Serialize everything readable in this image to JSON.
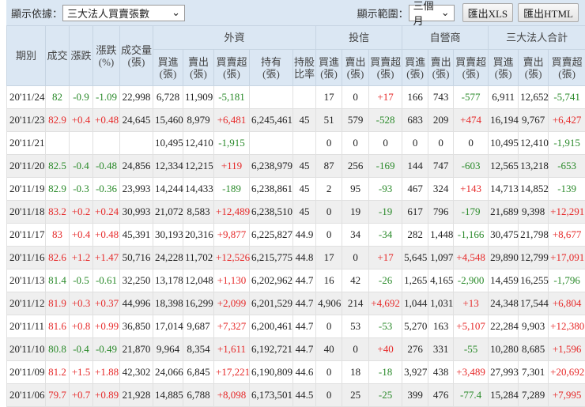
{
  "toolbar": {
    "basis_label": "顯示依據：",
    "basis_value": "三大法人買賣張數",
    "range_label": "顯示範圍：",
    "range_value": "三個月",
    "export_xls": "匯出XLS",
    "export_html": "匯出HTML"
  },
  "headers": {
    "period": "期別",
    "close": "成交",
    "change": "漲跌",
    "change_pct": "漲跌\n(%)",
    "volume": "成交量\n(張)",
    "groups": [
      "外資",
      "投信",
      "自營商",
      "三大法人合計"
    ],
    "sub": [
      "買進\n(張)",
      "賣出\n(張)",
      "買賣超\n(張)",
      "持有\n(張)",
      "持股\n比率",
      "買進\n(張)",
      "賣出\n(張)",
      "買賣超\n(張)",
      "買進\n(張)",
      "賣出\n(張)",
      "買賣超\n(張)",
      "買進\n(張)",
      "賣出\n(張)",
      "買賣超\n(張)"
    ]
  },
  "colors": {
    "up": "#e62a2a",
    "down": "#2a8a2a",
    "header_bg": "#dbe7f3"
  },
  "rows": [
    [
      "20'11/24",
      "82",
      "-0.9",
      "-1.09",
      "22,998",
      "6,728",
      "11,909",
      "-5,181",
      "",
      "",
      "17",
      "0",
      "+17",
      "166",
      "743",
      "-577",
      "6,911",
      "12,652",
      "-5,741"
    ],
    [
      "20'11/23",
      "82.9",
      "+0.4",
      "+0.48",
      "24,645",
      "15,460",
      "8,979",
      "+6,481",
      "6,245,461",
      "45",
      "51",
      "579",
      "-528",
      "683",
      "209",
      "+474",
      "16,194",
      "9,767",
      "+6,427"
    ],
    [
      "20'11/21",
      "",
      "",
      "",
      "",
      "10,495",
      "12,410",
      "-1,915",
      "",
      "",
      "0",
      "0",
      "0",
      "0",
      "0",
      "0",
      "10,495",
      "12,410",
      "-1,915"
    ],
    [
      "20'11/20",
      "82.5",
      "-0.4",
      "-0.48",
      "24,856",
      "12,334",
      "12,215",
      "+119",
      "6,238,979",
      "45",
      "87",
      "256",
      "-169",
      "144",
      "747",
      "-603",
      "12,565",
      "13,218",
      "-653"
    ],
    [
      "20'11/19",
      "82.9",
      "-0.3",
      "-0.36",
      "23,993",
      "14,244",
      "14,433",
      "-189",
      "6,238,861",
      "45",
      "2",
      "95",
      "-93",
      "467",
      "324",
      "+143",
      "14,713",
      "14,852",
      "-139"
    ],
    [
      "20'11/18",
      "83.2",
      "+0.2",
      "+0.24",
      "30,993",
      "21,072",
      "8,583",
      "+12,489",
      "6,238,510",
      "45",
      "0",
      "19",
      "-19",
      "617",
      "796",
      "-179",
      "21,689",
      "9,398",
      "+12,291"
    ],
    [
      "20'11/17",
      "83",
      "+0.4",
      "+0.48",
      "45,391",
      "30,193",
      "20,316",
      "+9,877",
      "6,225,827",
      "44.9",
      "0",
      "34",
      "-34",
      "282",
      "1,448",
      "-1,166",
      "30,475",
      "21,798",
      "+8,677"
    ],
    [
      "20'11/16",
      "82.6",
      "+1.2",
      "+1.47",
      "50,716",
      "24,228",
      "11,702",
      "+12,526",
      "6,215,775",
      "44.8",
      "17",
      "0",
      "+17",
      "5,645",
      "1,097",
      "+4,548",
      "29,890",
      "12,799",
      "+17,091"
    ],
    [
      "20'11/13",
      "81.4",
      "-0.5",
      "-0.61",
      "32,250",
      "13,178",
      "12,048",
      "+1,130",
      "6,202,962",
      "44.7",
      "16",
      "42",
      "-26",
      "1,265",
      "4,165",
      "-2,900",
      "14,459",
      "16,255",
      "-1,796"
    ],
    [
      "20'11/12",
      "81.9",
      "+0.3",
      "+0.37",
      "44,996",
      "18,398",
      "16,299",
      "+2,099",
      "6,201,529",
      "44.7",
      "4,906",
      "214",
      "+4,692",
      "1,044",
      "1,031",
      "+13",
      "24,348",
      "17,544",
      "+6,804"
    ],
    [
      "20'11/11",
      "81.6",
      "+0.8",
      "+0.99",
      "36,850",
      "17,014",
      "9,687",
      "+7,327",
      "6,200,461",
      "44.7",
      "0",
      "53",
      "-53",
      "5,270",
      "163",
      "+5,107",
      "22,284",
      "9,903",
      "+12,380"
    ],
    [
      "20'11/10",
      "80.8",
      "-0.4",
      "-0.49",
      "21,870",
      "9,964",
      "8,354",
      "+1,611",
      "6,192,721",
      "44.7",
      "40",
      "0",
      "+40",
      "276",
      "331",
      "-55",
      "10,280",
      "8,685",
      "+1,596"
    ],
    [
      "20'11/09",
      "81.2",
      "+1.5",
      "+1.88",
      "42,302",
      "24,066",
      "6,845",
      "+17,221",
      "6,190,809",
      "44.6",
      "0",
      "18",
      "-18",
      "3,927",
      "438",
      "+3,489",
      "27,993",
      "7,301",
      "+20,692"
    ],
    [
      "20'11/06",
      "79.7",
      "+0.7",
      "+0.89",
      "21,928",
      "14,885",
      "6,788",
      "+8,098",
      "6,173,501",
      "44.5",
      "0",
      "25",
      "-25",
      "399",
      "476",
      "-77.4",
      "15,284",
      "7,289",
      "+7,995"
    ]
  ]
}
